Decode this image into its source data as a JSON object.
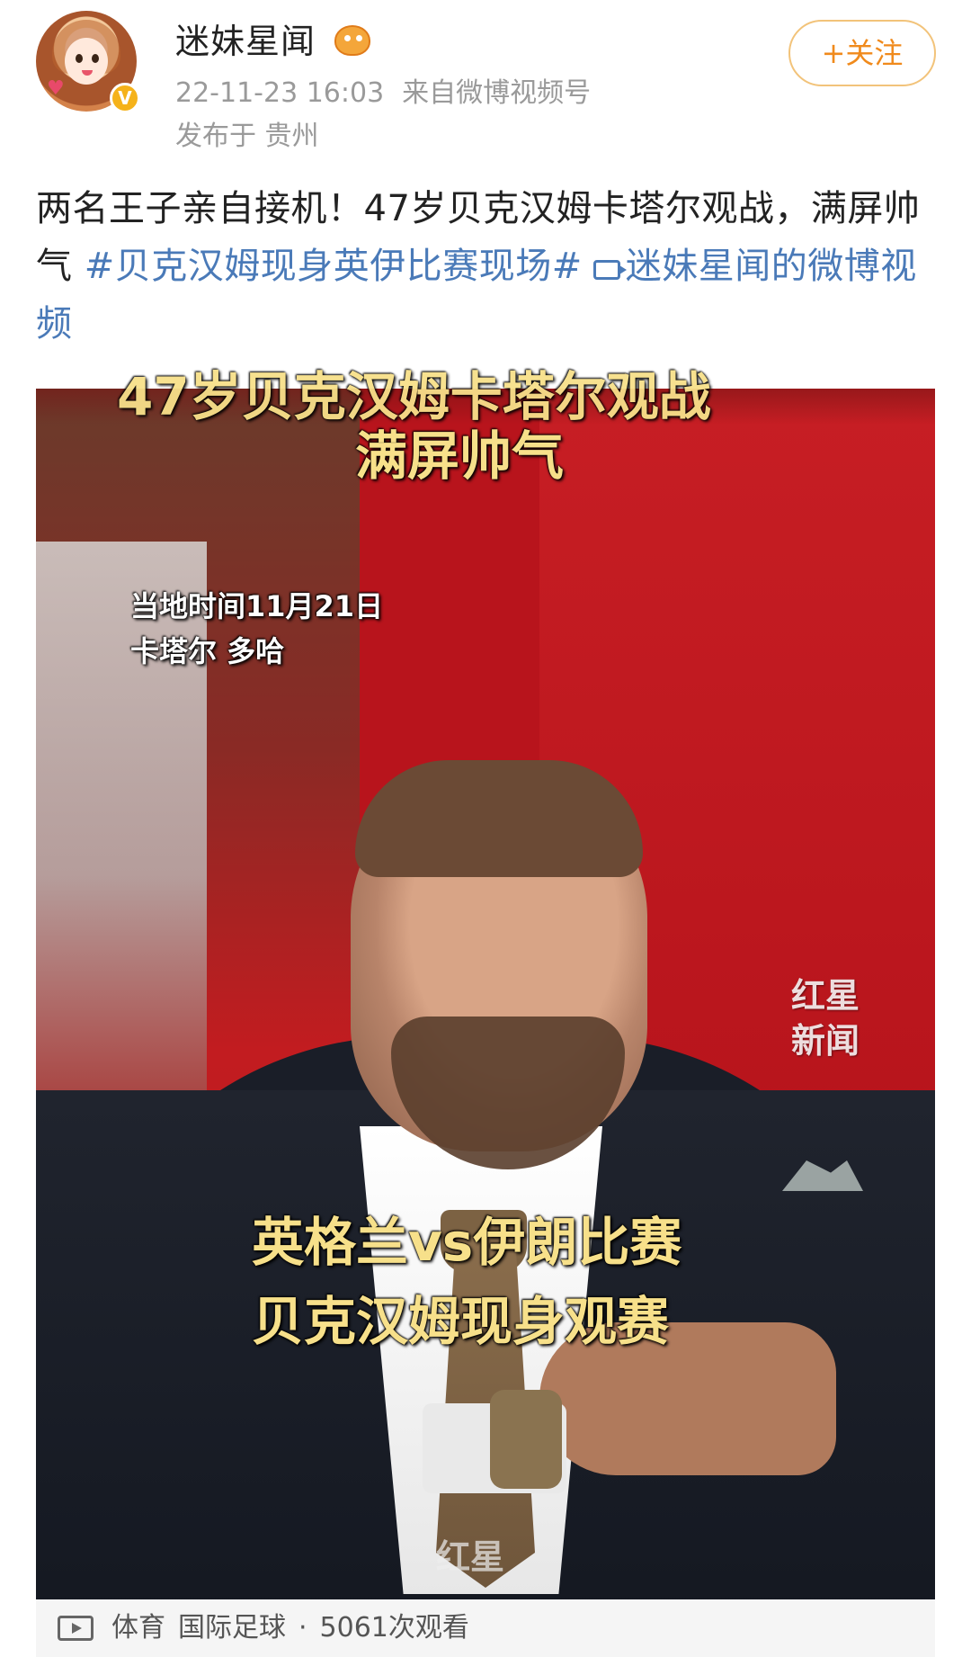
{
  "post": {
    "author": {
      "name": "迷妹星闻",
      "verified_badge": "V"
    },
    "time": "22-11-23 16:03",
    "source": "来自微博视频号",
    "location": "发布于 贵州",
    "follow_label": "+关注",
    "text": {
      "main": "两名王子亲自接机！47岁贝克汉姆卡塔尔观战，满屏帅气",
      "hashtag": "#贝克汉姆现身英伊比赛现场#",
      "video_link": "迷妹星闻的微博视频"
    }
  },
  "video": {
    "overlay_top_line1": "47岁贝克汉姆卡塔尔观战",
    "overlay_top_line2": "满屏帅气",
    "overlay_time": "当地时间11月21日",
    "overlay_place": "卡塔尔 多哈",
    "overlay_bottom_line1": "英格兰vs伊朗比赛",
    "overlay_bottom_line2": "贝克汉姆现身观赛",
    "watermark_line1": "红星",
    "watermark_line2": "新闻",
    "watermark_bottom": "红星",
    "footer": {
      "category": "体育",
      "subcategory": "国际足球",
      "separator": "·",
      "views": "5061次观看"
    }
  },
  "colors": {
    "link": "#4a7ab8",
    "follow": "#f08a1c",
    "meta": "#9a9a9a",
    "overlay_text": "#f7e08a"
  },
  "icons": [
    "avatar-image",
    "verified-badge-icon",
    "level-fish-icon",
    "video-link-icon",
    "video-play-icon"
  ]
}
